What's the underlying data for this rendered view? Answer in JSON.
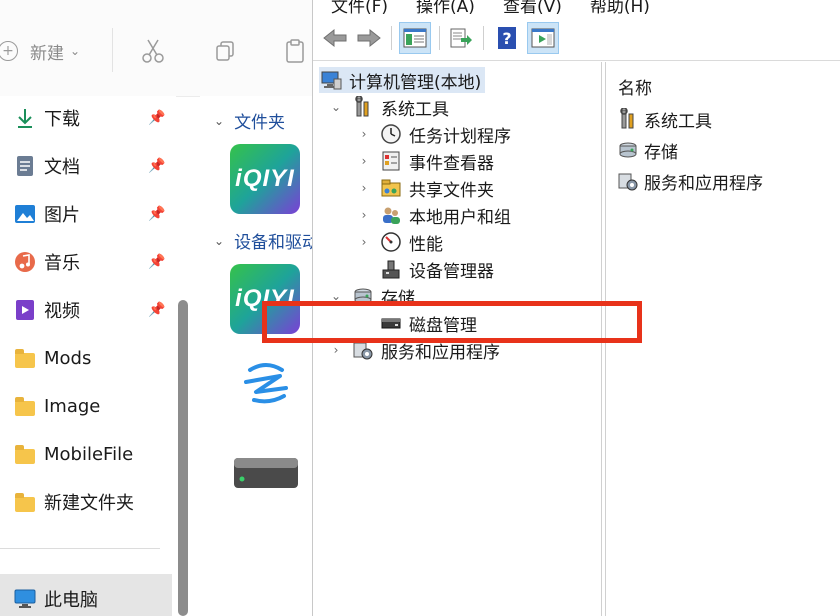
{
  "explorer": {
    "toolbar": {
      "new_label": "新建"
    },
    "nav": {
      "items": [
        {
          "label": "下载",
          "icon": "download-icon"
        },
        {
          "label": "文档",
          "icon": "document-icon"
        },
        {
          "label": "图片",
          "icon": "picture-icon"
        },
        {
          "label": "音乐",
          "icon": "music-icon"
        },
        {
          "label": "视频",
          "icon": "video-icon"
        },
        {
          "label": "Mods",
          "icon": "folder-icon"
        },
        {
          "label": "Image",
          "icon": "folder-icon"
        },
        {
          "label": "MobileFile",
          "icon": "folder-icon"
        },
        {
          "label": "新建文件夹",
          "icon": "folder-icon"
        }
      ],
      "this_pc": "此电脑"
    },
    "content": {
      "section_folders": "文件夹",
      "section_devices": "设备和驱动器",
      "app_logo_text": "iQIYI"
    }
  },
  "mmc": {
    "menu": [
      "文件(F)",
      "操作(A)",
      "查看(V)",
      "帮助(H)"
    ],
    "tree": {
      "root": "计算机管理(本地)",
      "system_tools": "系统工具",
      "task_scheduler": "任务计划程序",
      "event_viewer": "事件查看器",
      "shared_folders": "共享文件夹",
      "local_users": "本地用户和组",
      "performance": "性能",
      "device_manager": "设备管理器",
      "storage": "存储",
      "disk_management": "磁盘管理",
      "services_apps": "服务和应用程序"
    },
    "right": {
      "column_header": "名称",
      "items": [
        "系统工具",
        "存储",
        "服务和应用程序"
      ]
    }
  },
  "colors": {
    "highlight": "#e8321a",
    "selection": "#dbe7f5"
  }
}
